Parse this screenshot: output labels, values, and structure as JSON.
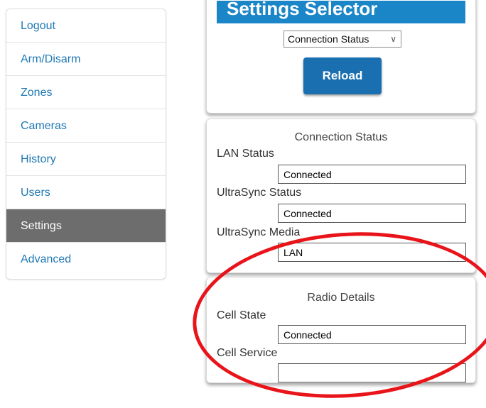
{
  "sidebar": {
    "items": [
      {
        "label": "Logout"
      },
      {
        "label": "Arm/Disarm"
      },
      {
        "label": "Zones"
      },
      {
        "label": "Cameras"
      },
      {
        "label": "History"
      },
      {
        "label": "Users"
      },
      {
        "label": "Settings",
        "active": true
      },
      {
        "label": "Advanced"
      }
    ]
  },
  "settings_selector": {
    "title": "Settings Selector",
    "selected_option": "Connection Status",
    "reload_label": "Reload"
  },
  "connection_status": {
    "title": "Connection Status",
    "fields": [
      {
        "label": "LAN Status",
        "value": "Connected"
      },
      {
        "label": "UltraSync Status",
        "value": "Connected"
      },
      {
        "label": "UltraSync Media",
        "value": "LAN"
      }
    ]
  },
  "radio_details": {
    "title": "Radio Details",
    "fields": [
      {
        "label": "Cell State",
        "value": "Connected"
      },
      {
        "label": "Cell Service",
        "value": ""
      }
    ]
  },
  "colors": {
    "accent": "#1a86c8",
    "button": "#1a6fb0",
    "active_nav": "#6d6d6d",
    "annotation": "#e8141a"
  }
}
